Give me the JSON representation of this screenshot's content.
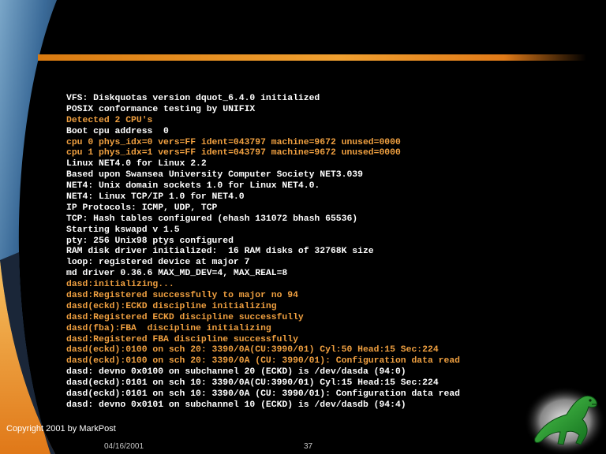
{
  "slide": {
    "console_lines": [
      {
        "text": "VFS: Diskquotas version dquot_6.4.0 initialized",
        "tone": "white"
      },
      {
        "text": "POSIX conformance testing by UNIFIX",
        "tone": "white"
      },
      {
        "text": "Detected 2 CPU's",
        "tone": "orange"
      },
      {
        "text": "Boot cpu address  0",
        "tone": "white"
      },
      {
        "text": "cpu 0 phys_idx=0 vers=FF ident=043797 machine=9672 unused=0000",
        "tone": "orange"
      },
      {
        "text": "cpu 1 phys_idx=1 vers=FF ident=043797 machine=9672 unused=0000",
        "tone": "orange"
      },
      {
        "text": "Linux NET4.0 for Linux 2.2",
        "tone": "white"
      },
      {
        "text": "Based upon Swansea University Computer Society NET3.039",
        "tone": "white"
      },
      {
        "text": "NET4: Unix domain sockets 1.0 for Linux NET4.0.",
        "tone": "white"
      },
      {
        "text": "NET4: Linux TCP/IP 1.0 for NET4.0",
        "tone": "white"
      },
      {
        "text": "IP Protocols: ICMP, UDP, TCP",
        "tone": "white"
      },
      {
        "text": "TCP: Hash tables configured (ehash 131072 bhash 65536)",
        "tone": "white"
      },
      {
        "text": "Starting kswapd v 1.5",
        "tone": "white"
      },
      {
        "text": "pty: 256 Unix98 ptys configured",
        "tone": "white"
      },
      {
        "text": "RAM disk driver initialized:  16 RAM disks of 32768K size",
        "tone": "white"
      },
      {
        "text": "loop: registered device at major 7",
        "tone": "white"
      },
      {
        "text": "md driver 0.36.6 MAX_MD_DEV=4, MAX_REAL=8",
        "tone": "white"
      },
      {
        "text": "dasd:initializing...",
        "tone": "orange"
      },
      {
        "text": "dasd:Registered successfully to major no 94",
        "tone": "orange"
      },
      {
        "text": "dasd(eckd):ECKD discipline initializing",
        "tone": "orange"
      },
      {
        "text": "dasd:Registered ECKD discipline successfully",
        "tone": "orange"
      },
      {
        "text": "dasd(fba):FBA  discipline initializing",
        "tone": "orange"
      },
      {
        "text": "dasd:Registered FBA discipline successfully",
        "tone": "orange"
      },
      {
        "text": "dasd(eckd):0100 on sch 20: 3390/0A(CU:3990/01) Cyl:50 Head:15 Sec:224",
        "tone": "orange"
      },
      {
        "text": "dasd(eckd):0100 on sch 20: 3390/0A (CU: 3990/01): Configuration data read",
        "tone": "orange"
      },
      {
        "text": "dasd: devno 0x0100 on subchannel 20 (ECKD) is /dev/dasda (94:0)",
        "tone": "white"
      },
      {
        "text": "dasd(eckd):0101 on sch 10: 3390/0A(CU:3990/01) Cyl:15 Head:15 Sec:224",
        "tone": "white"
      },
      {
        "text": "dasd(eckd):0101 on sch 10: 3390/0A (CU: 3990/01): Configuration data read",
        "tone": "white"
      },
      {
        "text": "dasd: devno 0x0101 on subchannel 10 (ECKD) is /dev/dasdb (94:4)",
        "tone": "white"
      }
    ],
    "copyright": "Copyright 2001 by MarkPost",
    "date": "04/16/2001",
    "page_number": "37",
    "mascot_icon": "green-dinosaur-icon"
  },
  "colors": {
    "background": "#000000",
    "accent": "#f0a040",
    "text": "#ffffff"
  }
}
